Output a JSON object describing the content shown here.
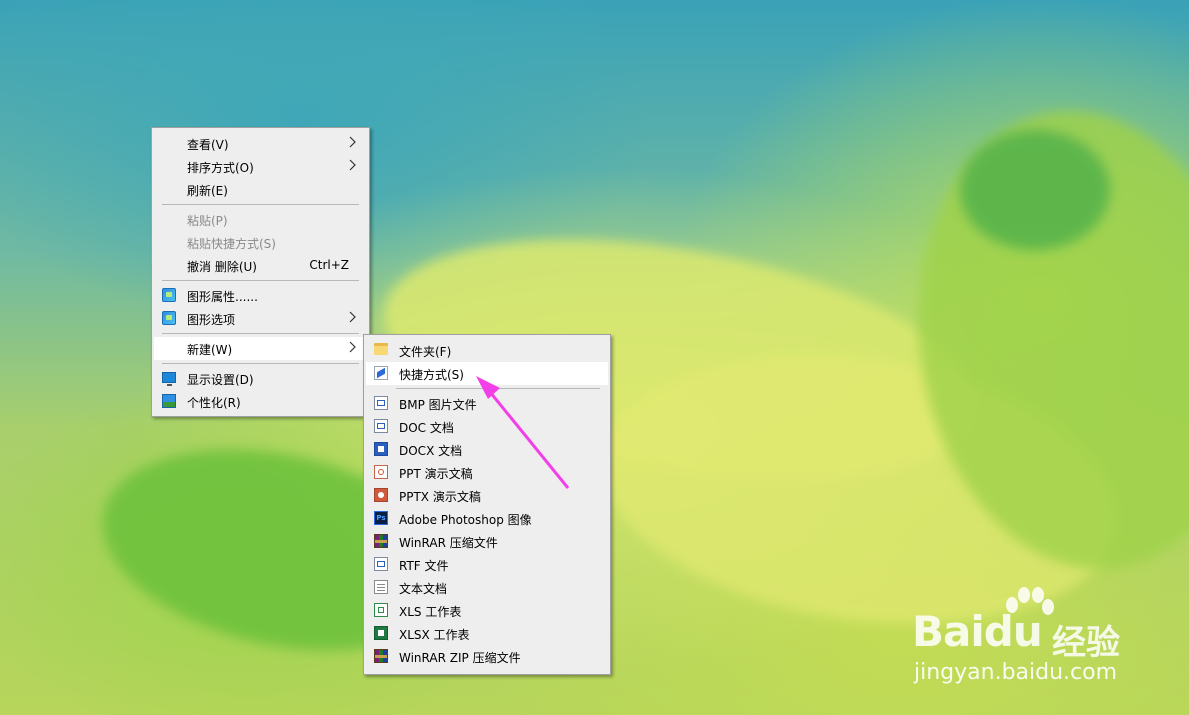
{
  "context_menu": {
    "items": [
      {
        "label": "查看(V)",
        "has_submenu": true
      },
      {
        "label": "排序方式(O)",
        "has_submenu": true
      },
      {
        "label": "刷新(E)"
      },
      {
        "label": "粘贴(P)",
        "disabled": true
      },
      {
        "label": "粘贴快捷方式(S)",
        "disabled": true
      },
      {
        "label": "撤消 删除(U)",
        "shortcut": "Ctrl+Z"
      },
      {
        "label": "图形属性......",
        "icon": "graphics-properties-icon"
      },
      {
        "label": "图形选项",
        "icon": "graphics-options-icon",
        "has_submenu": true
      },
      {
        "label": "新建(W)",
        "has_submenu": true,
        "highlighted": true
      },
      {
        "label": "显示设置(D)",
        "icon": "display-settings-icon"
      },
      {
        "label": "个性化(R)",
        "icon": "personalize-icon"
      }
    ]
  },
  "new_submenu": {
    "items": [
      {
        "label": "文件夹(F)",
        "icon": "folder-icon"
      },
      {
        "label": "快捷方式(S)",
        "icon": "shortcut-icon",
        "highlighted": true
      },
      {
        "label": "BMP 图片文件",
        "icon": "bmp-file-icon"
      },
      {
        "label": "DOC 文档",
        "icon": "doc-file-icon"
      },
      {
        "label": "DOCX 文档",
        "icon": "docx-file-icon"
      },
      {
        "label": "PPT 演示文稿",
        "icon": "ppt-file-icon"
      },
      {
        "label": "PPTX 演示文稿",
        "icon": "pptx-file-icon"
      },
      {
        "label": "Adobe Photoshop 图像",
        "icon": "photoshop-file-icon"
      },
      {
        "label": "WinRAR 压缩文件",
        "icon": "winrar-file-icon"
      },
      {
        "label": "RTF 文件",
        "icon": "rtf-file-icon"
      },
      {
        "label": "文本文档",
        "icon": "text-file-icon"
      },
      {
        "label": "XLS 工作表",
        "icon": "xls-file-icon"
      },
      {
        "label": "XLSX 工作表",
        "icon": "xlsx-file-icon"
      },
      {
        "label": "WinRAR ZIP 压缩文件",
        "icon": "winrar-zip-file-icon"
      }
    ]
  },
  "icon_glyphs": {
    "photoshop": "Ps"
  },
  "annotation": {
    "arrow_color": "#f23fe8"
  },
  "watermark": {
    "logo_text": "Bai",
    "logo_text_2": "du",
    "logo_cn": "经验",
    "url": "jingyan.baidu.com"
  },
  "colors": {
    "menu_background": "#eeeeee",
    "menu_highlight": "#ffffff",
    "menu_border": "#a0a0a0",
    "disabled_text": "#8a8a8a"
  }
}
